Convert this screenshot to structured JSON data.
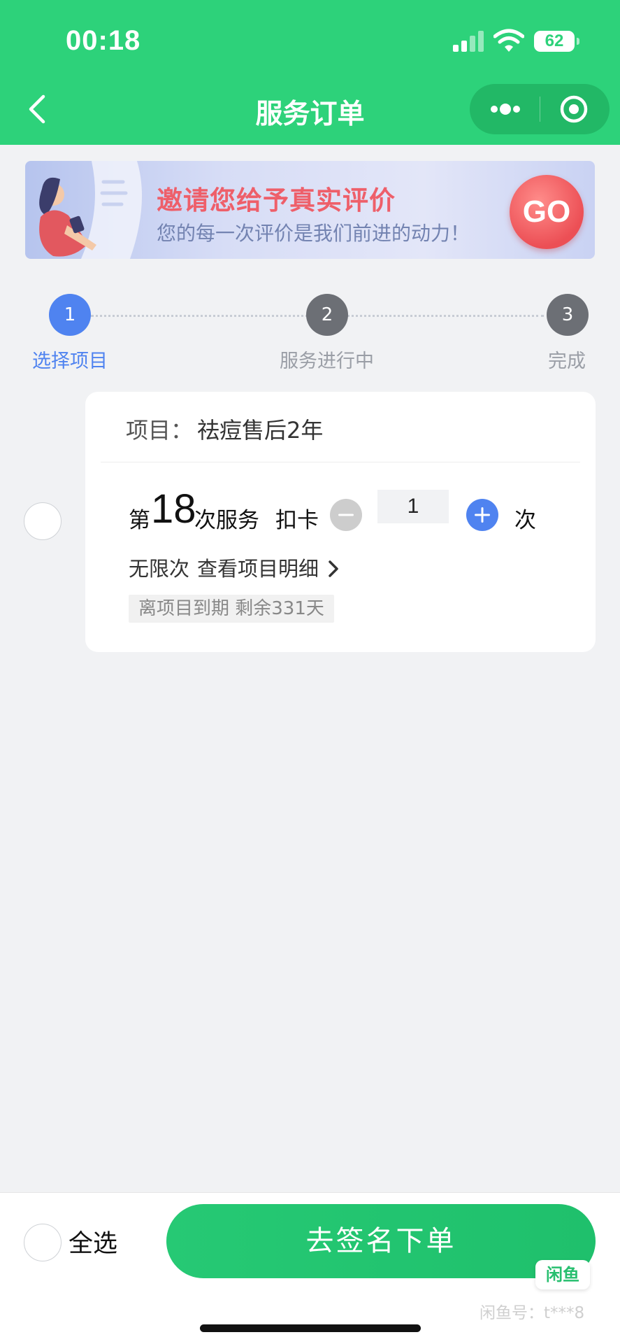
{
  "status_bar": {
    "time": "00:18",
    "battery": "62"
  },
  "nav": {
    "title": "服务订单"
  },
  "banner": {
    "title": "邀请您给予真实评价",
    "subtitle": "您的每一次评价是我们前进的动力！",
    "go_label": "GO"
  },
  "steps": [
    {
      "number": "1",
      "label": "选择项目",
      "active": true
    },
    {
      "number": "2",
      "label": "服务进行中",
      "active": false
    },
    {
      "number": "3",
      "label": "完成",
      "active": false
    }
  ],
  "colors": {
    "brand_green": "#2dd27a",
    "step_active": "#4f83f0",
    "step_inactive": "#6c6f75",
    "banner_accent": "#ee5f6a"
  },
  "card": {
    "project_label": "项目：",
    "project_name": "祛痘售后2年",
    "service_prefix": "第",
    "service_number": "18",
    "service_suffix": "次服务",
    "deduct_label": "扣卡",
    "quantity": "1",
    "times_label": "次",
    "unlimited": "无限次",
    "detail_link": "查看项目明细",
    "expire_text": "离项目到期 剩余331天"
  },
  "footer": {
    "select_all": "全选",
    "submit": "去签名下单",
    "watermark_badge": "闲鱼",
    "watermark_text": "闲鱼号：t***8"
  }
}
